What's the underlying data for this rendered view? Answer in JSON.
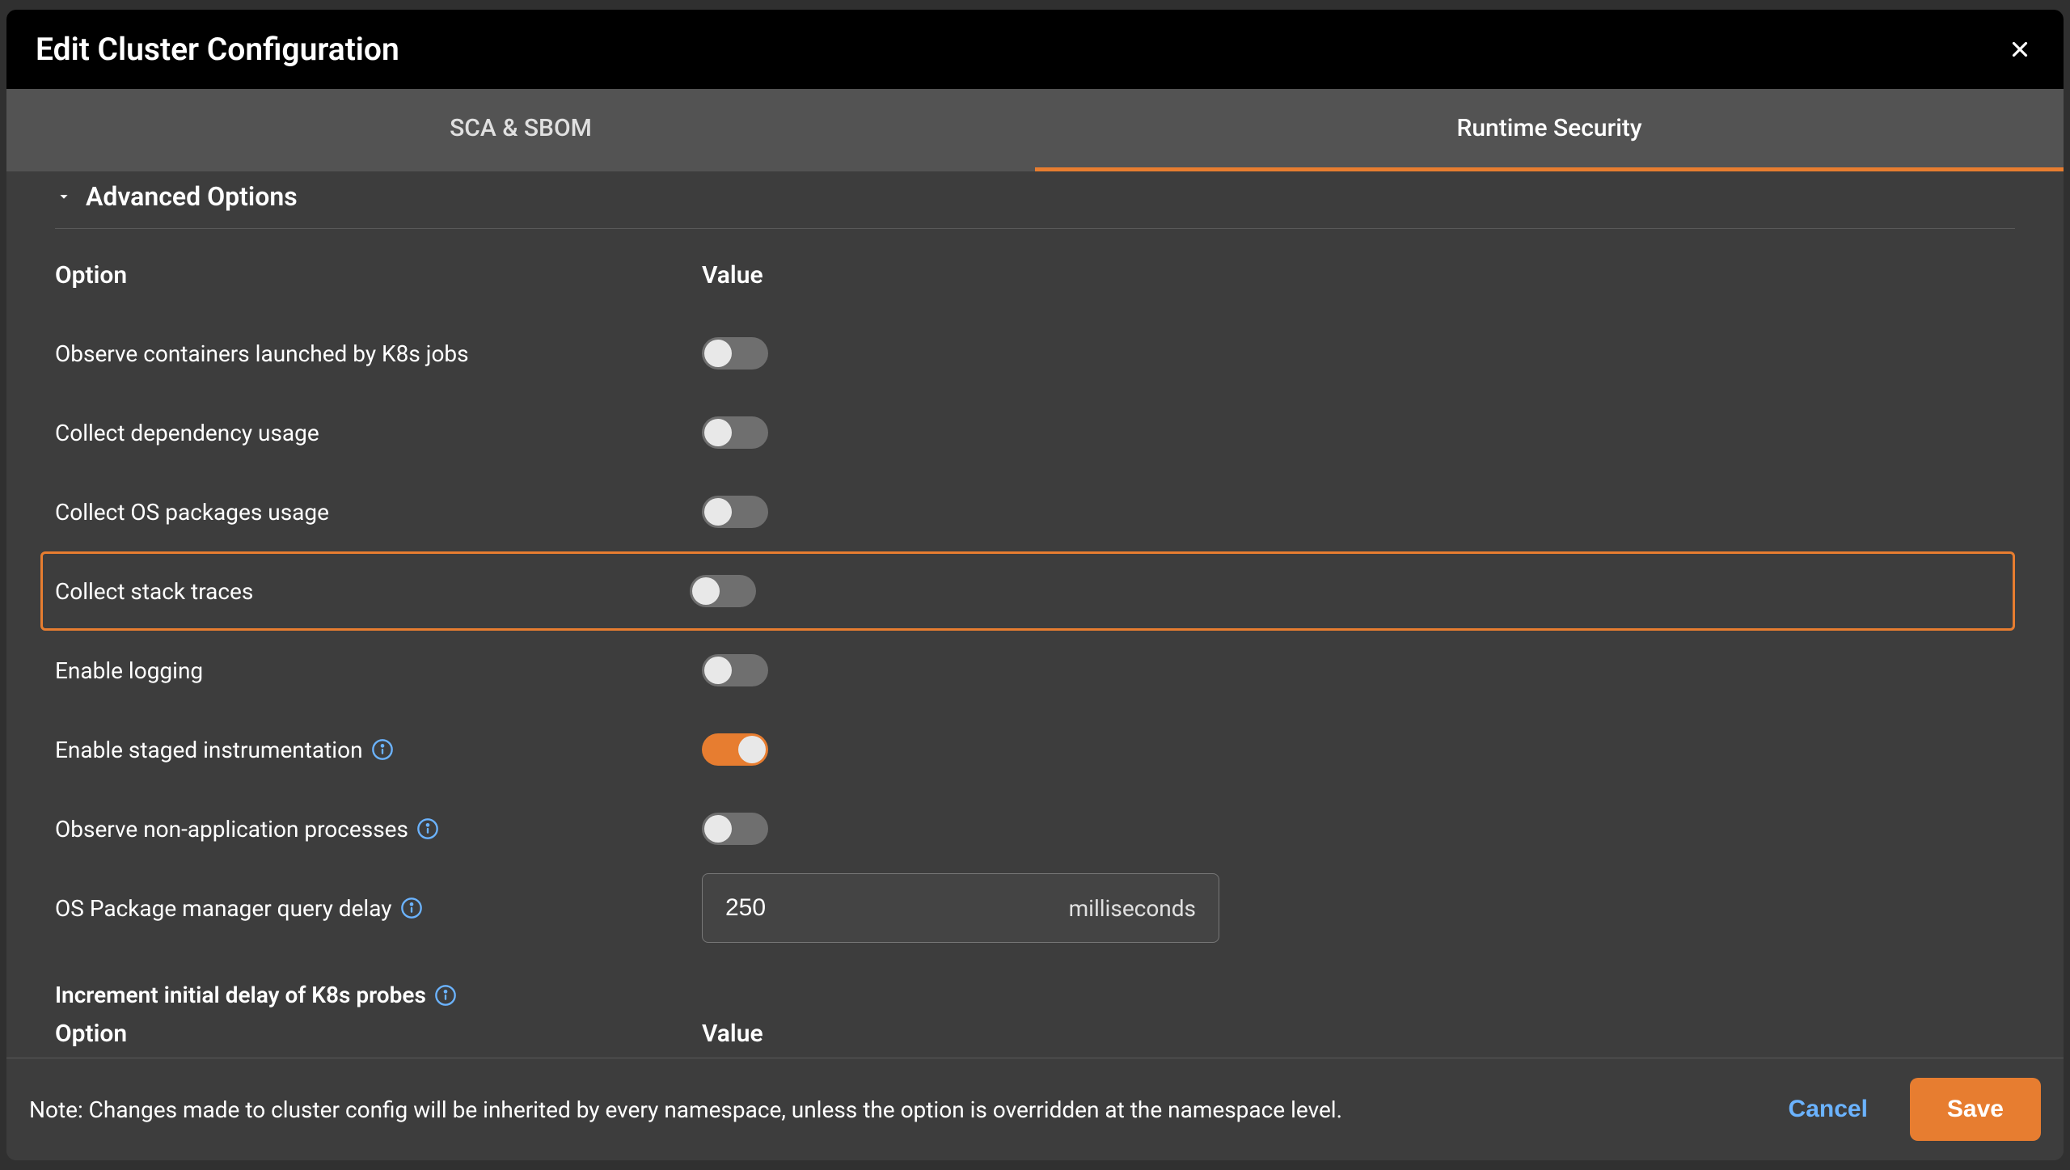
{
  "modal": {
    "title": "Edit Cluster Configuration"
  },
  "tabs": {
    "sca": "SCA & SBOM",
    "runtime": "Runtime Security"
  },
  "section": {
    "advanced_options": "Advanced Options"
  },
  "headers": {
    "option": "Option",
    "value": "Value"
  },
  "options": {
    "observe_k8s_jobs": {
      "label": "Observe containers launched by K8s jobs",
      "value": false
    },
    "collect_dependency": {
      "label": "Collect dependency usage",
      "value": false
    },
    "collect_os_packages": {
      "label": "Collect OS packages usage",
      "value": false
    },
    "collect_stack_traces": {
      "label": "Collect stack traces",
      "value": false
    },
    "enable_logging": {
      "label": "Enable logging",
      "value": false
    },
    "enable_staged_instrumentation": {
      "label": "Enable staged instrumentation",
      "value": true,
      "has_info": true
    },
    "observe_non_app": {
      "label": "Observe non-application processes",
      "value": false,
      "has_info": true
    },
    "os_pkg_query_delay": {
      "label": "OS Package manager query delay",
      "value": "250",
      "unit": "milliseconds",
      "has_info": true
    }
  },
  "subsection": {
    "k8s_probes": "Increment initial delay of K8s probes"
  },
  "footer": {
    "note": "Note: Changes made to cluster config will be inherited by every namespace, unless the option is overridden at the namespace level.",
    "cancel": "Cancel",
    "save": "Save"
  }
}
